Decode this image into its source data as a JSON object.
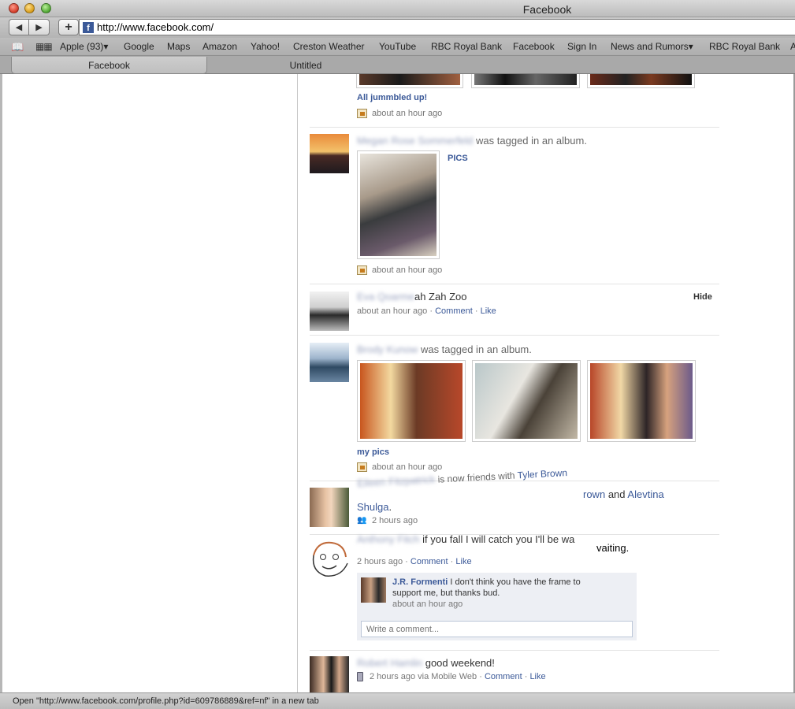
{
  "window": {
    "title": "Facebook"
  },
  "toolbar": {
    "back": "◀",
    "forward": "▶",
    "add": "+",
    "url": "http://www.facebook.com/",
    "favicon": "f"
  },
  "bookmarks": [
    "Apple (93)▾",
    "Google",
    "Maps",
    "Amazon",
    "Yahoo!",
    "Creston Weather",
    "YouTube",
    "RBC Royal Bank",
    "Facebook",
    "Sign In",
    "News and Rumors▾",
    "RBC Royal Bank",
    "A"
  ],
  "tabs": [
    {
      "label": "Facebook"
    },
    {
      "label": "Untitled"
    }
  ],
  "feed": {
    "story1": {
      "album_title": "All jummbled up!",
      "time": "about an hour ago"
    },
    "story2": {
      "actor": "Megan Rose Sommerfeld",
      "action": "was tagged in an album.",
      "album_title": "PICS",
      "time": "about an hour ago"
    },
    "story3": {
      "actor": "Eva Qoarme",
      "text_tail": "ah Zah Zoo",
      "hide": "Hide",
      "time": "about an hour ago",
      "comment": "Comment",
      "like": "Like",
      "sep": "·"
    },
    "story4": {
      "actor": "Brody Kunow",
      "action": "was tagged in an album.",
      "album_title": "my pics",
      "time": "about an hour ago"
    },
    "story5": {
      "actor": "Eileen Fitzpatrick",
      "action": "is now friends with",
      "friend1": "Tyler Brown",
      "friend1_tail": "rown",
      "and": "and",
      "friend2": "Alevtina",
      "friend2_line2": "Shulga",
      "period": ".",
      "time": "2 hours ago"
    },
    "story6": {
      "actor": "Anthony Fitch",
      "text": "if you fall I will catch you I'll be wa",
      "text_tail": "vaiting.",
      "time": "2 hours ago",
      "comment": "Comment",
      "like": "Like",
      "sep": "·",
      "reply": {
        "author": "J.R. Formenti",
        "text_line1": "I don't think you have the frame to",
        "text_line2": "support me, but thanks bud.",
        "time": "about an hour ago"
      },
      "input_placeholder": "Write a comment..."
    },
    "story7": {
      "actor": "Robert Hamlin",
      "text": "good weekend!",
      "time": "2 hours ago via Mobile Web",
      "comment": "Comment",
      "like": "Like",
      "sep": "·"
    }
  },
  "statusbar": {
    "text": "Open \"http://www.facebook.com/profile.php?id=609786889&ref=nf\" in a new tab"
  }
}
